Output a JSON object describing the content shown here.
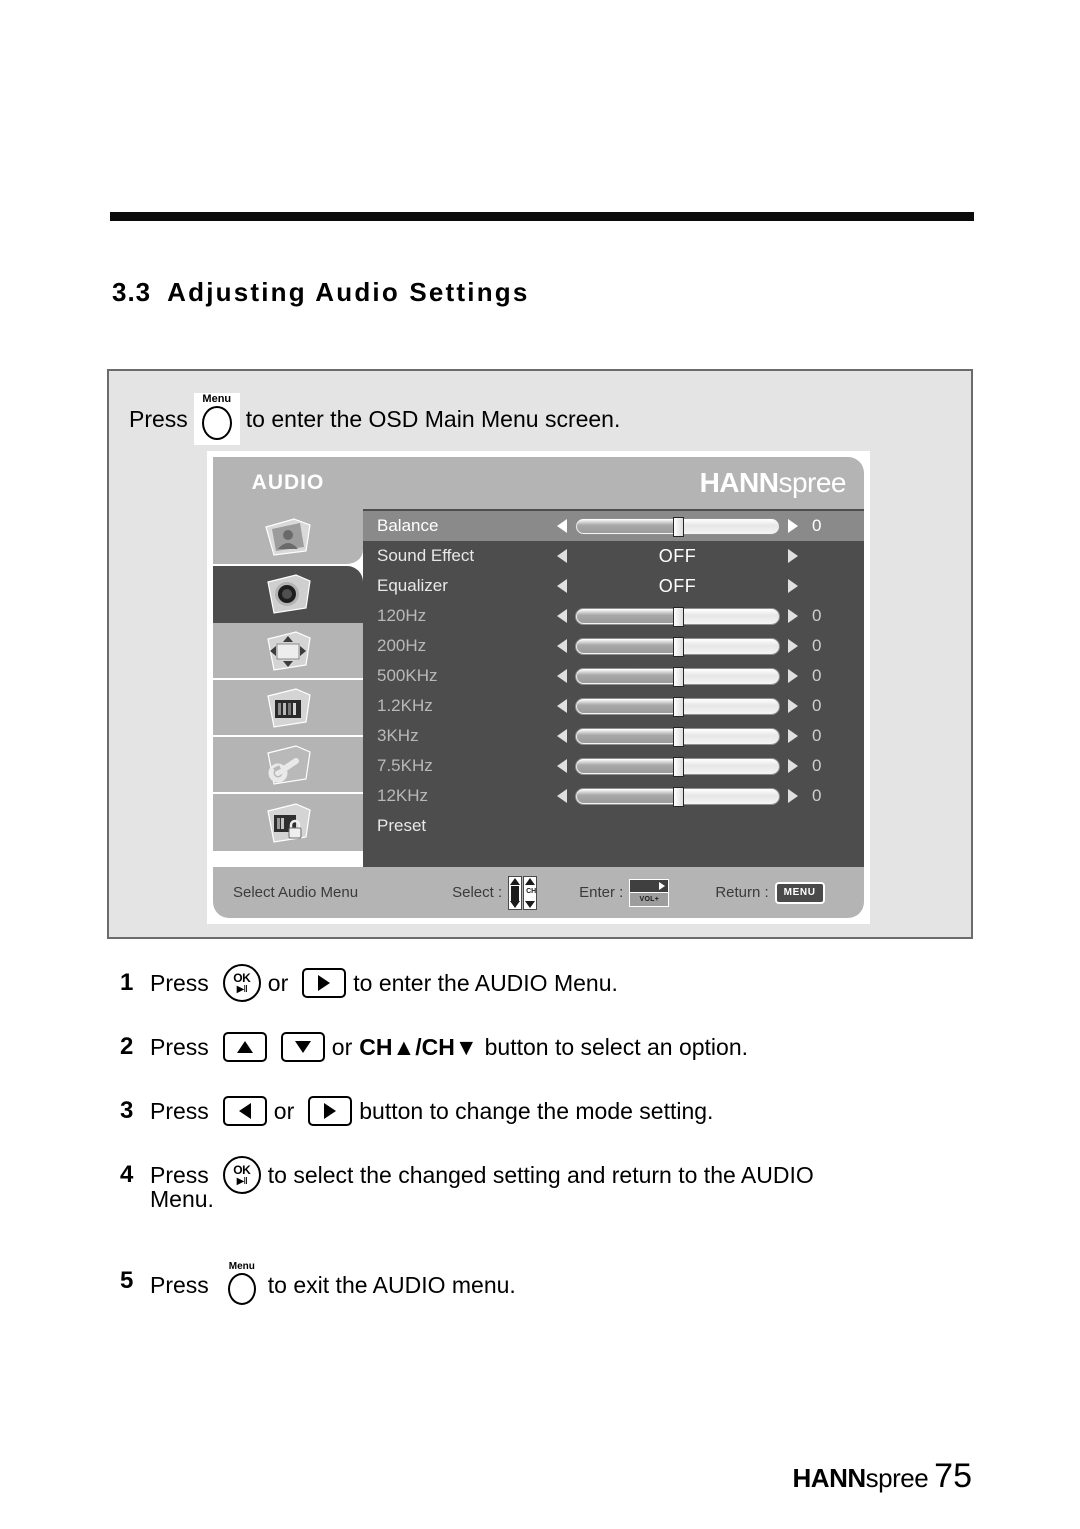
{
  "document": {
    "section_number": "3.3",
    "section_title": "Adjusting Audio Settings",
    "footer_brand_bold": "HANN",
    "footer_brand_light": "spree",
    "page_number": "75"
  },
  "intro": {
    "press_word": "Press",
    "menu_key_label": "Menu",
    "rest": "to enter the OSD Main Menu screen."
  },
  "osd": {
    "tab_label": "AUDIO",
    "brand_bold": "HANN",
    "brand_light": "spree",
    "rail": [
      {
        "name": "picture-icon"
      },
      {
        "name": "audio-icon",
        "selected": true
      },
      {
        "name": "position-icon"
      },
      {
        "name": "screen-icon"
      },
      {
        "name": "setup-icon"
      },
      {
        "name": "lock-icon"
      }
    ],
    "rows": [
      {
        "label": "Balance",
        "type": "slider",
        "value": "0",
        "fill": 50,
        "thumb": 50,
        "highlight": true,
        "dim": false
      },
      {
        "label": "Sound Effect",
        "type": "option",
        "value": "OFF",
        "highlight": false,
        "dim": false
      },
      {
        "label": "Equalizer",
        "type": "option",
        "value": "OFF",
        "highlight": false,
        "dim": false
      },
      {
        "label": "120Hz",
        "type": "slider",
        "value": "0",
        "fill": 50,
        "thumb": 50,
        "highlight": false,
        "dim": true
      },
      {
        "label": "200Hz",
        "type": "slider",
        "value": "0",
        "fill": 50,
        "thumb": 50,
        "highlight": false,
        "dim": true
      },
      {
        "label": "500KHz",
        "type": "slider",
        "value": "0",
        "fill": 50,
        "thumb": 50,
        "highlight": false,
        "dim": true
      },
      {
        "label": "1.2KHz",
        "type": "slider",
        "value": "0",
        "fill": 50,
        "thumb": 50,
        "highlight": false,
        "dim": true
      },
      {
        "label": "3KHz",
        "type": "slider",
        "value": "0",
        "fill": 50,
        "thumb": 50,
        "highlight": false,
        "dim": true
      },
      {
        "label": "7.5KHz",
        "type": "slider",
        "value": "0",
        "fill": 50,
        "thumb": 50,
        "highlight": false,
        "dim": true
      },
      {
        "label": "12KHz",
        "type": "slider",
        "value": "0",
        "fill": 50,
        "thumb": 50,
        "highlight": false,
        "dim": true
      },
      {
        "label": "Preset",
        "type": "plain",
        "value": "",
        "highlight": false,
        "dim": false
      }
    ],
    "status": {
      "hint": "Select Audio Menu",
      "select_label": "Select :",
      "select_key": "CH",
      "enter_label": "Enter :",
      "enter_key": "VOL+",
      "return_label": "Return :",
      "return_key": "MENU"
    }
  },
  "steps": [
    {
      "num": "1",
      "press": "Press",
      "key1": "ok-key",
      "ok_top": "OK",
      "ok_bottom": "▶II",
      "or": "or",
      "key2": "right-arrow-key",
      "tail": "to enter the AUDIO Menu."
    },
    {
      "num": "2",
      "press": "Press",
      "key1": "up-arrow-key",
      "key2": "down-arrow-key",
      "or": "or",
      "ch_text": "CH▲/CH▼",
      "tail": "button to select an option."
    },
    {
      "num": "3",
      "press": "Press",
      "key1": "left-arrow-key",
      "or": "or",
      "key2": "right-arrow-key",
      "tail": "button to change the mode setting."
    },
    {
      "num": "4",
      "press": "Press",
      "ok_top": "OK",
      "ok_bottom": "▶II",
      "tail": "to select the changed setting and return to the AUDIO",
      "tail2": "Menu."
    },
    {
      "num": "5",
      "press": "Press",
      "menu_key_label": "Menu",
      "tail": "to exit the AUDIO menu."
    }
  ],
  "colors": {
    "osd_dark": "#4d4d4d",
    "osd_light": "#b4b4b4",
    "osd_highlight": "#8a8a8a",
    "panel_bg": "#e4e4e4",
    "rule": "#0b0b0b"
  }
}
